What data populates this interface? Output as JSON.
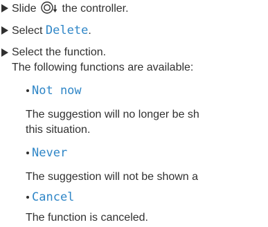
{
  "steps": [
    {
      "before": "Slide ",
      "icon": "controller-slide-down-icon",
      "after": " the controller."
    },
    {
      "before": "Select ",
      "term": "Delete",
      "after": "."
    },
    {
      "text": "Select the function.",
      "continuation": "The following functions are available:"
    }
  ],
  "options": [
    {
      "label": "Not now",
      "description_lines": [
        "The suggestion will no longer be sh",
        "this situation."
      ]
    },
    {
      "label": "Never",
      "description_lines": [
        "The suggestion will not be shown a"
      ]
    },
    {
      "label": "Cancel",
      "description_lines": [
        "The function is canceled."
      ]
    }
  ],
  "colors": {
    "text": "#303030",
    "term": "#2f86c7"
  }
}
